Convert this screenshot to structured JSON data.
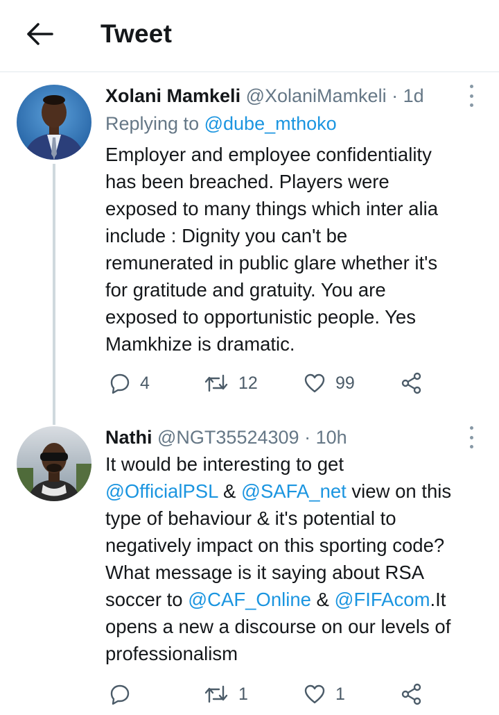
{
  "header": {
    "title": "Tweet"
  },
  "tweets": [
    {
      "name": "Xolani Mamkeli",
      "handle": "@XolaniMamkeli",
      "separator": "·",
      "time": "1d",
      "replying_prefix": "Replying to",
      "replying_to": "@dube_mthoko",
      "lines": [
        "Employer and employee confidentiality",
        "has been breached. Players were",
        "exposed to many things which inter alia",
        "include : Dignity you can't be",
        "remunerated in public glare whether it's",
        "for  gratitude and gratuity. You are",
        "exposed to opportunistic people. Yes",
        "Mamkhize is dramatic."
      ],
      "reply_count": "4",
      "retweet_count": "12",
      "like_count": "99"
    },
    {
      "name": "Nathi",
      "handle": "@NGT35524309",
      "separator": "·",
      "time": "10h",
      "lines": [
        {
          "t1": "It would be interesting to get"
        },
        {
          "m1": "@OfficialPSL",
          "t1": " & ",
          "m2": "@SAFA_net",
          "t2": " view on this"
        },
        {
          "t1": "type of behaviour & it's potential to"
        },
        {
          "t1": "negatively impact on this sporting code?"
        },
        {
          "t1": "What message is it saying about RSA"
        },
        {
          "t0": "soccer to ",
          "m1": "@CAF_Online",
          "t1": " & ",
          "m2": "@FIFAcom",
          "t2": ".It"
        },
        {
          "t1": "opens a new a discourse on our levels of"
        },
        {
          "t1": "professionalism"
        }
      ],
      "reply_count": "",
      "retweet_count": "1",
      "like_count": "1"
    }
  ],
  "icons": {
    "back": "arrow-left-icon",
    "more": "more-vertical-icon",
    "reply": "comment-bubble-icon",
    "retweet": "retweet-icon",
    "like": "heart-icon",
    "share": "share-icon"
  },
  "colors": {
    "link": "#1b95e0",
    "secondary_text": "#657786",
    "icon": "#4b5b68",
    "divider": "#e1e8ed"
  }
}
